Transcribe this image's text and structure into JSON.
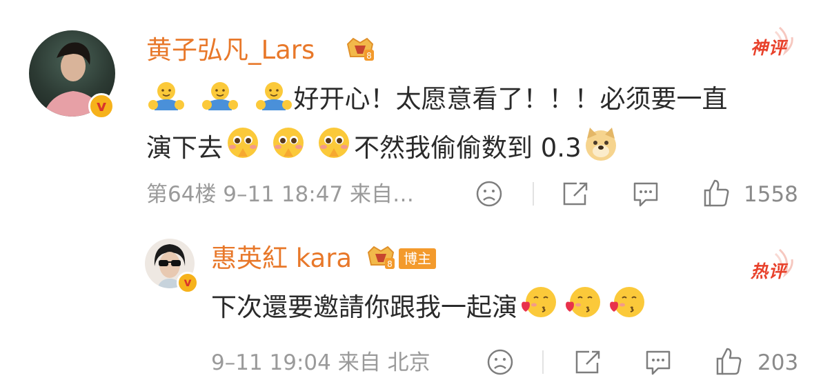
{
  "comment1": {
    "username": "黄子弘凡_Lars",
    "tag": "神评",
    "text_line1": "好开心！太愿意看了！！！必须要一直",
    "text_line2a": "演下去",
    "text_line2b": "不然我偷偷数到 0.3",
    "meta": "第64楼 9–11 18:47 来自…",
    "likes": "1558",
    "icons": [
      "hug-emoji",
      "hug-emoji",
      "hug-emoji",
      "pleading-emoji",
      "pleading-emoji",
      "pleading-emoji",
      "doge-emoji"
    ]
  },
  "reply": {
    "username": "惠英紅 kara",
    "chip": "博主",
    "tag": "热评",
    "text": "下次還要邀請你跟我一起演",
    "meta": "9–11 19:04 来自 北京",
    "likes": "203",
    "icons": [
      "kissing-heart-emoji",
      "kissing-heart-emoji",
      "kissing-heart-emoji"
    ]
  },
  "colors": {
    "username": "#e8782a",
    "tag": "#e8412b",
    "meta": "#9a9a9a",
    "chip": "#f39a2c"
  }
}
